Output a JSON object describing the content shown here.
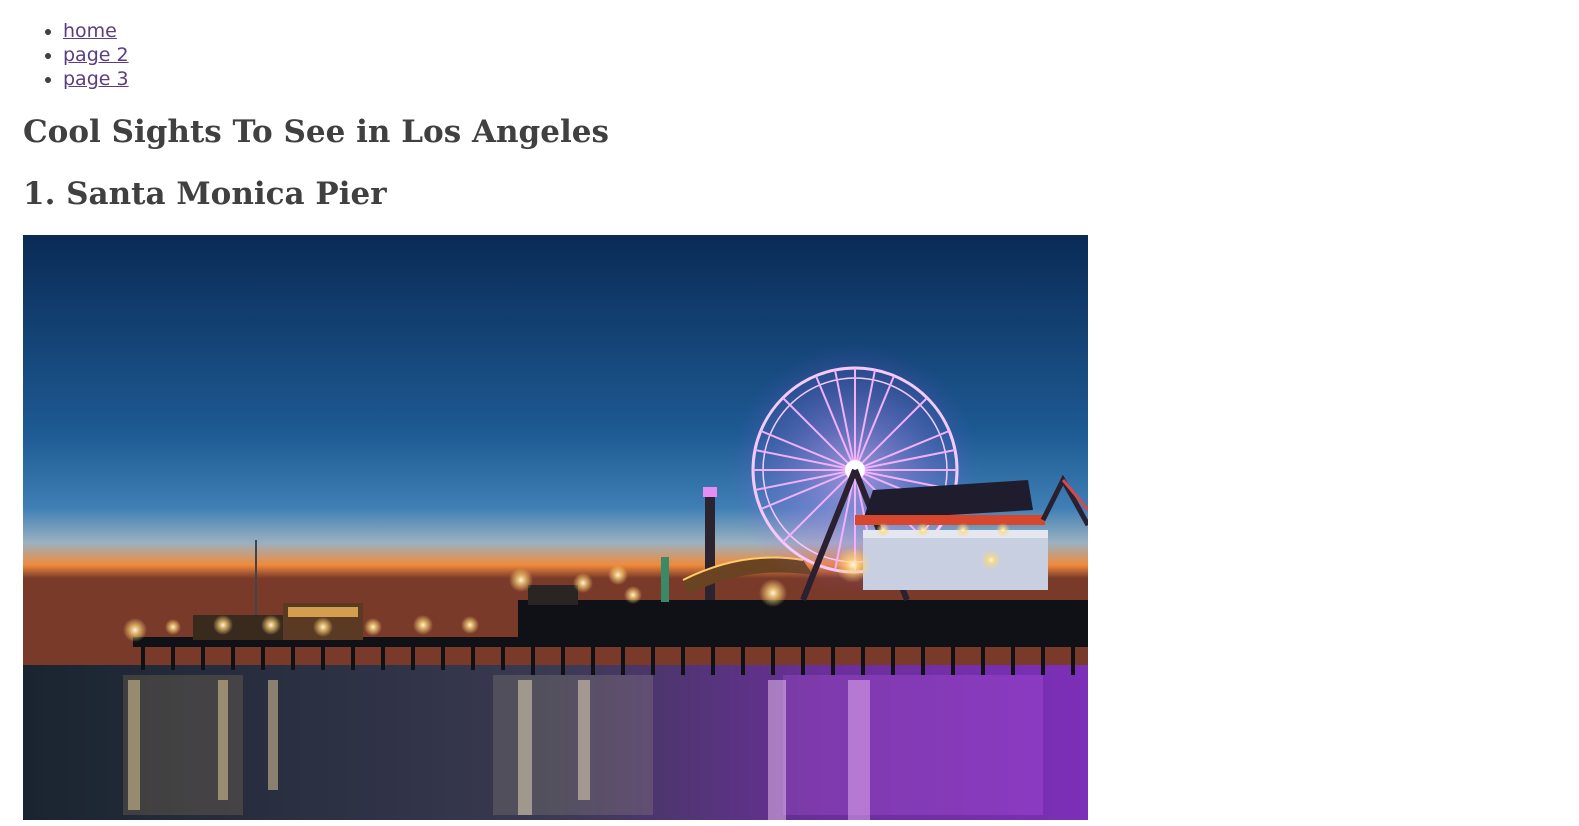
{
  "nav": {
    "items": [
      {
        "label": "home"
      },
      {
        "label": "page 2"
      },
      {
        "label": "page 3"
      }
    ]
  },
  "page": {
    "title": "Cool Sights To See in Los Angeles"
  },
  "sections": [
    {
      "heading": "1. Santa Monica Pier",
      "image": {
        "subject": "Santa Monica Pier at dusk with illuminated Ferris wheel",
        "icon": "photo-image"
      }
    }
  ],
  "colors": {
    "text": "#404040",
    "link": "#5a3e7e",
    "sky_top": "#0b2f5c",
    "sky_horizon": "#f08a3c",
    "wheel_glow": "#e58cf5",
    "water_purple": "#9b3fd6"
  }
}
